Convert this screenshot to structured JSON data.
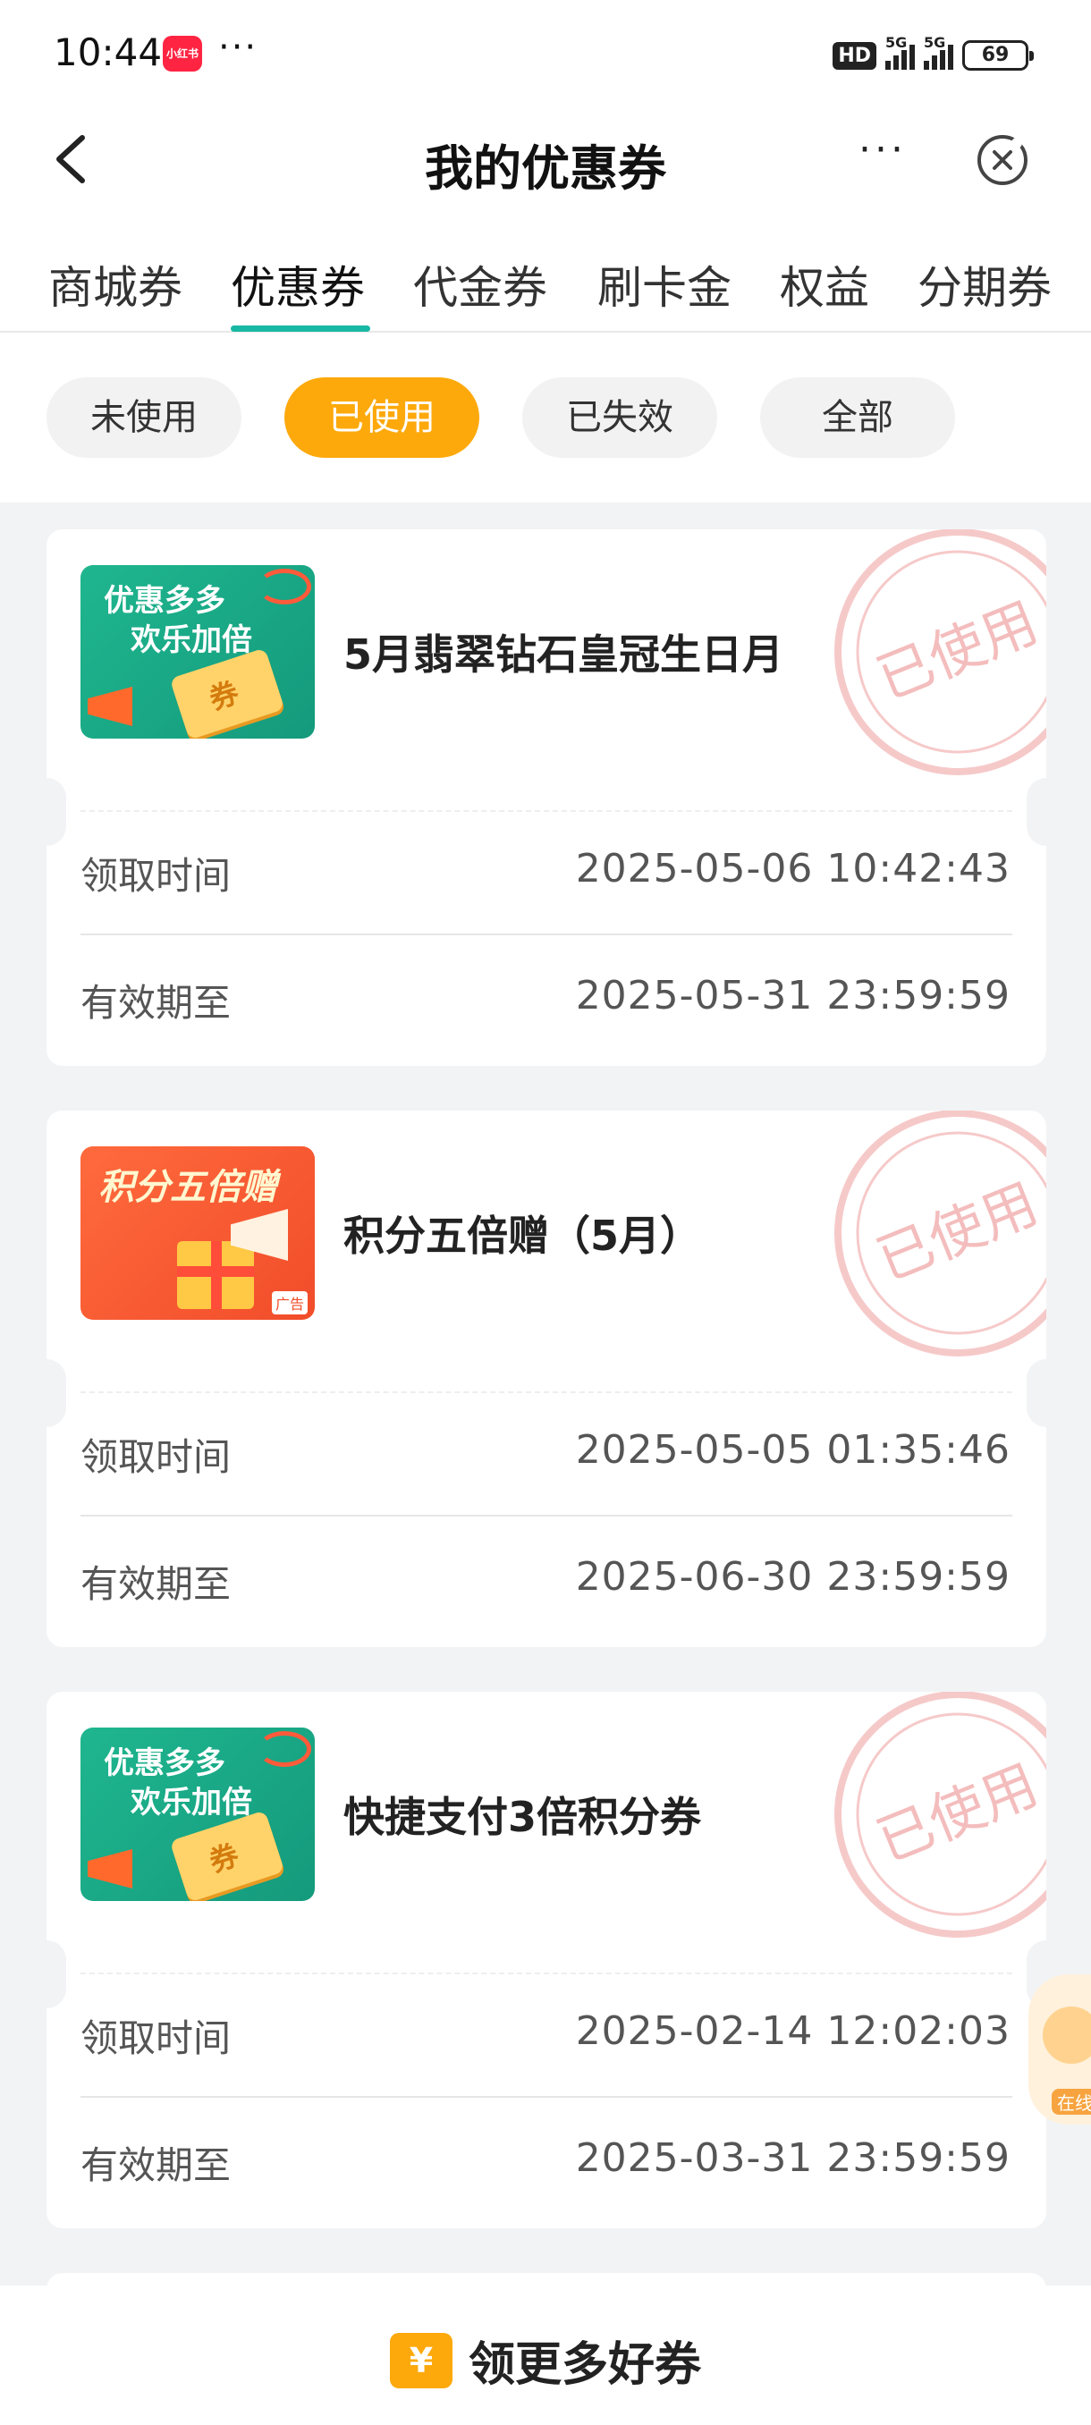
{
  "status_bar": {
    "time": "10:44",
    "app_icon_label": "小红书",
    "more": "···",
    "hd": "HD",
    "signal1": "5G",
    "signal2": "5G",
    "battery": "69"
  },
  "header": {
    "title": "我的优惠券",
    "more_label": "···"
  },
  "tabs": [
    {
      "label": "商城券"
    },
    {
      "label": "优惠券",
      "active": true
    },
    {
      "label": "代金券"
    },
    {
      "label": "刷卡金"
    },
    {
      "label": "权益"
    },
    {
      "label": "分期券"
    }
  ],
  "filters": [
    {
      "label": "未使用"
    },
    {
      "label": "已使用",
      "active": true
    },
    {
      "label": "已失效"
    },
    {
      "label": "全部"
    }
  ],
  "coupons": [
    {
      "thumb_text_1": "优惠多多",
      "thumb_text_2": "欢乐加倍",
      "title": "5月翡翠钻石皇冠生日月",
      "stamp_text": "已使用",
      "received_label": "领取时间",
      "received_value": "2025-05-06 10:42:43",
      "expiry_label": "有效期至",
      "expiry_value": "2025-05-31 23:59:59"
    },
    {
      "thumb_text_1": "积分五倍赠",
      "thumb_tag": "广告",
      "title": "积分五倍赠（5月）",
      "stamp_text": "已使用",
      "received_label": "领取时间",
      "received_value": "2025-05-05 01:35:46",
      "expiry_label": "有效期至",
      "expiry_value": "2025-06-30 23:59:59"
    },
    {
      "thumb_text_1": "优惠多多",
      "thumb_text_2": "欢乐加倍",
      "title": "快捷支付3倍积分券",
      "stamp_text": "已使用",
      "received_label": "领取时间",
      "received_value": "2025-02-14 12:02:03",
      "expiry_label": "有效期至",
      "expiry_value": "2025-03-31 23:59:59"
    }
  ],
  "float_service": {
    "label": "在线"
  },
  "bottom": {
    "icon_glyph": "¥",
    "label": "领更多好券"
  },
  "colors": {
    "accent_teal": "#19b8a4",
    "accent_orange": "#fda90c",
    "stamp_red": "#f3a0a0"
  }
}
